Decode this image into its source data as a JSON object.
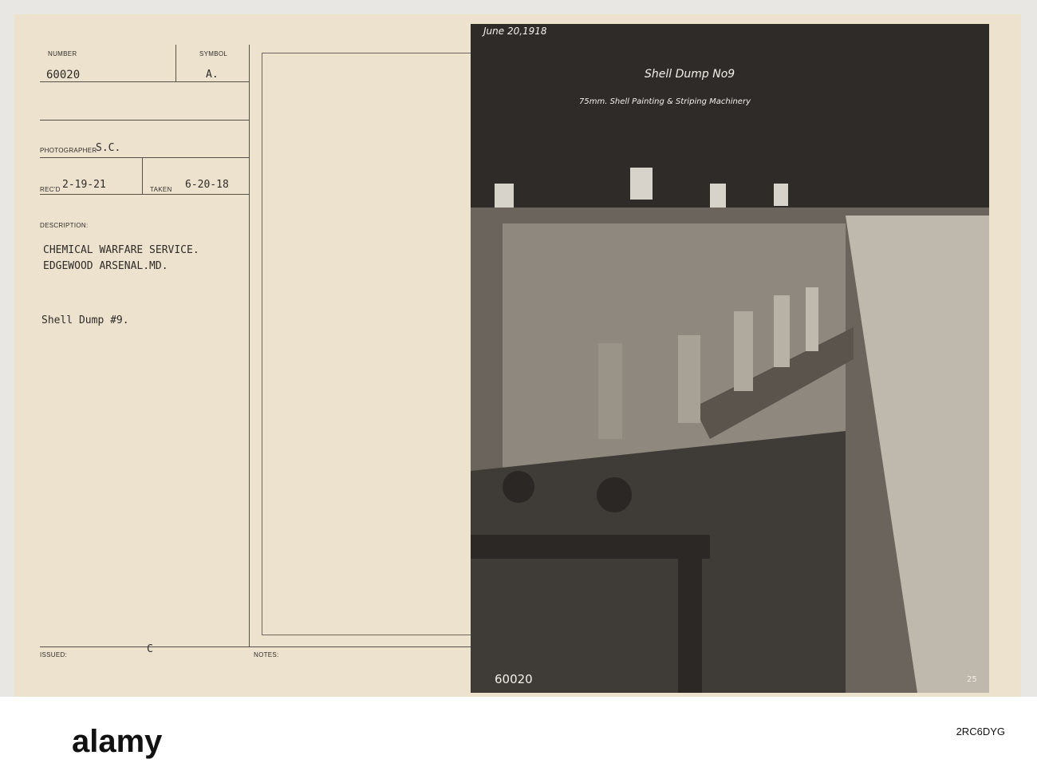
{
  "card": {
    "number_label": "NUMBER",
    "number": "60020",
    "symbol_label": "SYMBOL",
    "symbol": "A.",
    "photographer_label": "PHOTOGRAPHER",
    "photographer": "S.C.",
    "recd_label": "REC'D",
    "recd": "2-19-21",
    "taken_label": "TAKEN",
    "taken": "6-20-18",
    "description_label": "DESCRIPTION:",
    "description_line1": "CHEMICAL WARFARE SERVICE.",
    "description_line2": "EDGEWOOD ARSENAL.MD.",
    "subject": "Shell Dump #9.",
    "issued_label": "ISSUED:",
    "issued": "C",
    "notes_label": "NOTES:"
  },
  "photo": {
    "date": "June 20,1918",
    "title": "Shell Dump No9",
    "caption": "75mm. Shell Painting & Striping Machinery",
    "ref_number": "60020",
    "plate_number": "25"
  },
  "watermark": {
    "brand": "alamy",
    "image_code": "2RC6DYG"
  }
}
